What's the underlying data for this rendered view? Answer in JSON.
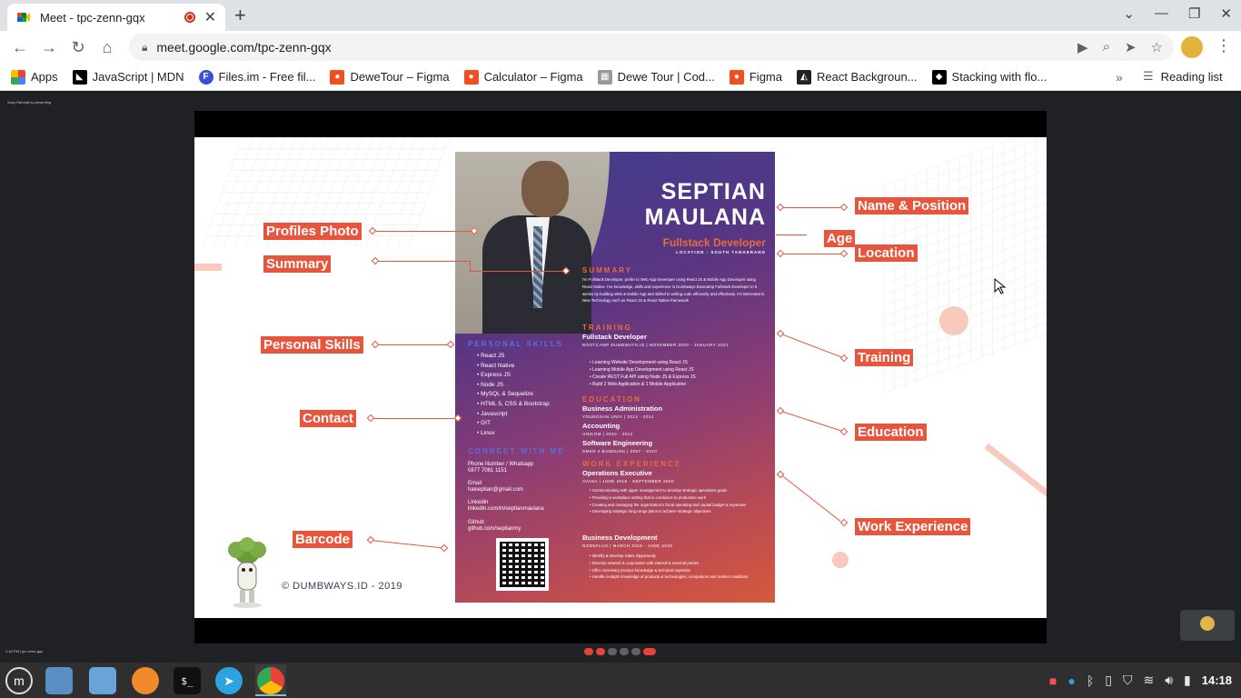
{
  "browser": {
    "tab_title": "Meet - tpc-zenn-gqx",
    "tab_close": "✕",
    "new_tab": "+",
    "window_controls": [
      "⌄",
      "—",
      "❐",
      "✕"
    ],
    "url": "meet.google.com/tpc-zenn-gqx"
  },
  "bookmarks": {
    "items": [
      {
        "label": "Apps",
        "color": "#4285f4"
      },
      {
        "label": "JavaScript | MDN",
        "color": "#000000"
      },
      {
        "label": "Files.im - Free fil...",
        "color": "#3b4fd8"
      },
      {
        "label": "DeweTour – Figma",
        "color": "#f24e1e"
      },
      {
        "label": "Calculator – Figma",
        "color": "#f24e1e"
      },
      {
        "label": "Dewe Tour | Cod...",
        "color": "#999999"
      },
      {
        "label": "Figma",
        "color": "#f24e1e"
      },
      {
        "label": "React Backgroun...",
        "color": "#222222"
      },
      {
        "label": "Stacking with flo...",
        "color": "#000000"
      }
    ],
    "more": "»",
    "reading_list": "Reading list"
  },
  "meet": {
    "presenting_banner": "Sony Rahmat is presenting",
    "bottom_info": "2:18 PM  |  tpc-zenn-gqx"
  },
  "slide": {
    "labels": {
      "profiles_photo": "Profiles Photo",
      "summary": "Summary",
      "personal_skills": "Personal Skills",
      "contact": "Contact",
      "barcode": "Barcode",
      "name_position": "Name & Position",
      "age": "Age",
      "location": "Location",
      "training": "Training",
      "education": "Education",
      "work_experience": "Work Experience"
    },
    "copyright": "© DUMBWAYS.ID - 2019",
    "accent_color": "#e8553d"
  },
  "resume": {
    "first_name": "SEPTIAN",
    "last_name": "MAULANA",
    "position": "Fullstack Developer",
    "location": "LOCATION : SOUTH TANGERANG",
    "summary_heading": "SUMMARY",
    "summary_text": "I'm Fullstack Developer, prefer to Web App Developer using React JS & Mobile App Developer using React Native. I've knowledge, skills and experience in Dumbways Bootcamp Fullstack Developer in 5 weeks by building Web & Mobile App and skilled in writing code efficiently and effectively. I'm interested in New Technology such as React JS & React Native framework",
    "skills_heading": "PERSONAL SKILLS",
    "skills": [
      "React JS",
      "React Native",
      "Express JS",
      "Node JS",
      "MySQL & Sequelize",
      "HTML 5, CSS & Bootstrap",
      "Javascript",
      "GIT",
      "Linux"
    ],
    "connect_heading": "CONNECT WITH ME",
    "contacts": [
      {
        "label": "Phone Number / Whatsapp",
        "value": "0877 7061 1151"
      },
      {
        "label": "Email",
        "value": "haiseptian@gmail.com"
      },
      {
        "label": "Linkedin",
        "value": "linkedin.com/in/septianmaulana"
      },
      {
        "label": "Github",
        "value": "github.com/septianmy"
      }
    ],
    "training_heading": "TRAINING",
    "training_title": "Fullstack Developer",
    "training_date": "BOOTCAMP DUMBWAYS.ID | NOVEMBER 2020 - JANUARY 2021",
    "training_items": [
      "Learning Website Development using React JS",
      "Learning Mobile App Development using React JS",
      "Create REST Full API using Node JS & Express JS",
      "Build 2 Web Application & 1 Mobile Application"
    ],
    "education_heading": "EDUCATION",
    "education": [
      {
        "title": "Business Administration",
        "date": "YOUNGSAN UNIV | 2012 - 2014"
      },
      {
        "title": "Accounting",
        "date": "UNIKOM | 2010 - 2012"
      },
      {
        "title": "Software Engineering",
        "date": "SMKN 4 BANDUNG | 2007 - 2010"
      }
    ],
    "work_heading": "WORK EXPERIENCE",
    "work": [
      {
        "title": "Operations Executive",
        "date": "AVANA | JUNE 2018 - SEPTEMBER 2020",
        "items": [
          "Communicating with upper management to develop strategic operations goals",
          "Providing a workplace setting that is conducive to productive work",
          "Creating and managing the organization's fiscal operating and capital budget & expenses",
          "Developing strategic long-range plans to achieve strategic objectives"
        ]
      },
      {
        "title": "Business Development",
        "date": "NODEFLUX | MARCH 2019 - JUNE 2020",
        "items": [
          "Identify & Develop Sales Opportunity",
          "Develop network & corporation with internal & external parties",
          "Offer necessary product knowledge & technical expertise",
          "Handle in-depth knowledge of products & technologies, competitors and market conditions"
        ]
      }
    ]
  },
  "taskbar": {
    "clock": "14:18",
    "terminal_glyph": "$_"
  }
}
